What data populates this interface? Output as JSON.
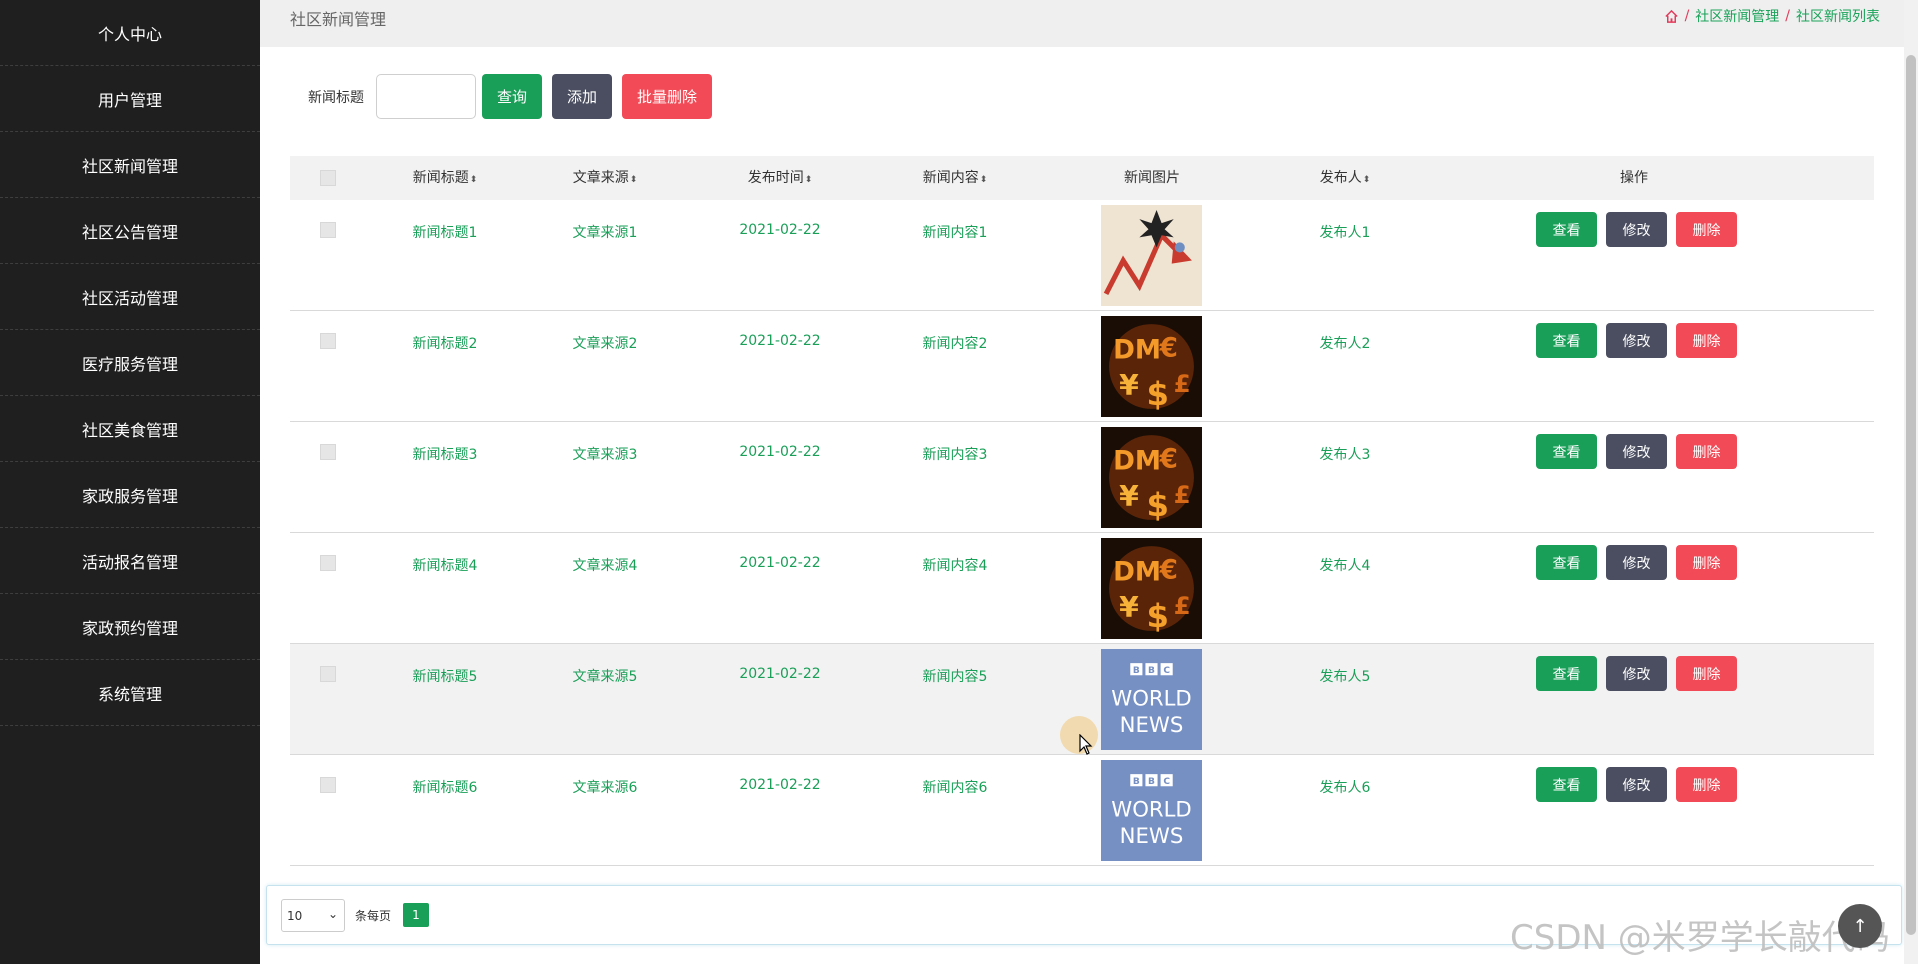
{
  "sidebar": {
    "items": [
      "个人中心",
      "用户管理",
      "社区新闻管理",
      "社区公告管理",
      "社区活动管理",
      "医疗服务管理",
      "社区美食管理",
      "家政服务管理",
      "活动报名管理",
      "家政预约管理",
      "系统管理"
    ]
  },
  "header": {
    "title": "社区新闻管理",
    "breadcrumb": [
      "社区新闻管理",
      "社区新闻列表"
    ],
    "sep": "/"
  },
  "search": {
    "label": "新闻标题",
    "value": "",
    "buttons": {
      "query": "查询",
      "add": "添加",
      "batch_delete": "批量删除"
    }
  },
  "table": {
    "columns": [
      "新闻标题",
      "文章来源",
      "发布时间",
      "新闻内容",
      "新闻图片",
      "发布人",
      "操作"
    ],
    "sort_icon": "⬍",
    "actions": {
      "view": "查看",
      "edit": "修改",
      "delete": "删除"
    },
    "rows": [
      {
        "title": "新闻标题1",
        "source": "文章来源1",
        "date": "2021-02-22",
        "content": "新闻内容1",
        "image": "chart-arrow",
        "author": "发布人1"
      },
      {
        "title": "新闻标题2",
        "source": "文章来源2",
        "date": "2021-02-22",
        "content": "新闻内容2",
        "image": "currency-fire",
        "author": "发布人2"
      },
      {
        "title": "新闻标题3",
        "source": "文章来源3",
        "date": "2021-02-22",
        "content": "新闻内容3",
        "image": "currency-fire",
        "author": "发布人3"
      },
      {
        "title": "新闻标题4",
        "source": "文章来源4",
        "date": "2021-02-22",
        "content": "新闻内容4",
        "image": "currency-fire",
        "author": "发布人4"
      },
      {
        "title": "新闻标题5",
        "source": "文章来源5",
        "date": "2021-02-22",
        "content": "新闻内容5",
        "image": "bbc",
        "author": "发布人5"
      },
      {
        "title": "新闻标题6",
        "source": "文章来源6",
        "date": "2021-02-22",
        "content": "新闻内容6",
        "image": "bbc",
        "author": "发布人6"
      }
    ]
  },
  "bbc_logo": {
    "bbc": "BBC",
    "world": "WORLD",
    "news": "NEWS"
  },
  "pager": {
    "page_size": "10",
    "per_page_label": "条每页",
    "current_page": "1"
  },
  "watermark": "CSDN @米罗学长敲代码",
  "colors": {
    "sidebar_bg": "#1f1f1f",
    "green": "#1a9f58",
    "dark": "#4a4e60",
    "red": "#f24a56",
    "bbc_blue": "#7690c4"
  }
}
